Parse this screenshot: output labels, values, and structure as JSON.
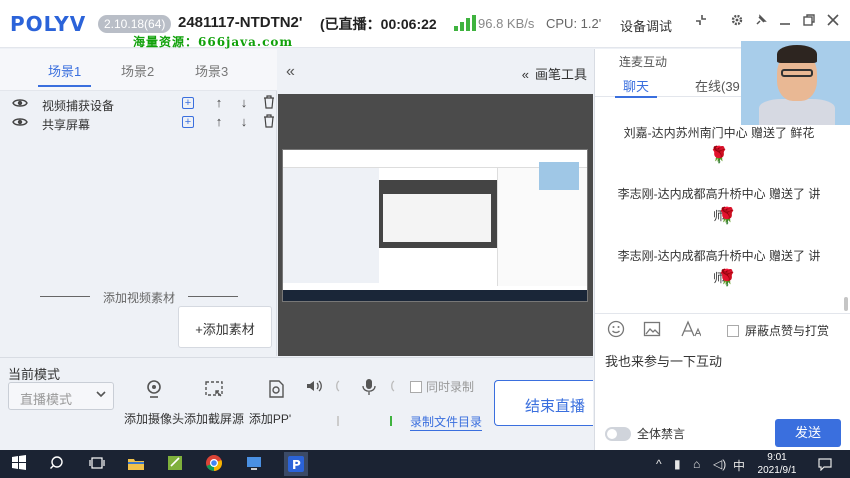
{
  "titlebar": {
    "logo": "POLYV",
    "version": "2.10.18(64)",
    "room": "2481117-NTDTN2'",
    "live_status": "(已直播：00:06:22",
    "watermark": "海量资源：666java.com",
    "netspeed": "96.8 KB/s",
    "cpu": "CPU: 1.2'",
    "device_debug": "设备调试",
    "icons": [
      "shrink-icon",
      "gear-icon",
      "pin-icon",
      "minimize-icon",
      "restore-icon",
      "close-icon"
    ]
  },
  "scenes": {
    "tabs": [
      "场景1",
      "场景2",
      "场景3"
    ],
    "active_index": 0,
    "sources": [
      {
        "label": "视频捕获设备"
      },
      {
        "label": "共享屏幕"
      }
    ],
    "add_material_divider": "添加视频素材",
    "add_material_button": "+添加素材"
  },
  "preview": {
    "pen_tool": "画笔工具"
  },
  "bottom": {
    "mode_label": "当前模式",
    "mode_value": "直播模式",
    "actions": [
      {
        "label": "添加摄像头",
        "icon": "camera-icon"
      },
      {
        "label": "添加截屏源",
        "icon": "screenshot-icon"
      },
      {
        "label": "添加PP'",
        "icon": "ppt-icon"
      }
    ],
    "sync_record": "同时录制",
    "record_dir": "录制文件目录",
    "end_live": "结束直播"
  },
  "chat": {
    "section_title": "连麦互动",
    "tabs": [
      "聊天",
      "在线(39"
    ],
    "active_tab": 0,
    "messages": [
      {
        "text": "刘嘉-达内苏州南门中心 赠送了 鲜花"
      },
      {
        "text": "李志刚-达内成都高升桥中心 赠送了 讲师"
      },
      {
        "text": "李志刚-达内成都高升桥中心 赠送了 讲师"
      }
    ],
    "block_gifts": "屏蔽点赞与打赏",
    "input_text": "我也来参与一下互动",
    "mute_all": "全体禁言",
    "send": "发送"
  },
  "taskbar": {
    "ime": "中",
    "time": "9:01",
    "date": "2021/9/1",
    "accent": "#3a6fde"
  }
}
